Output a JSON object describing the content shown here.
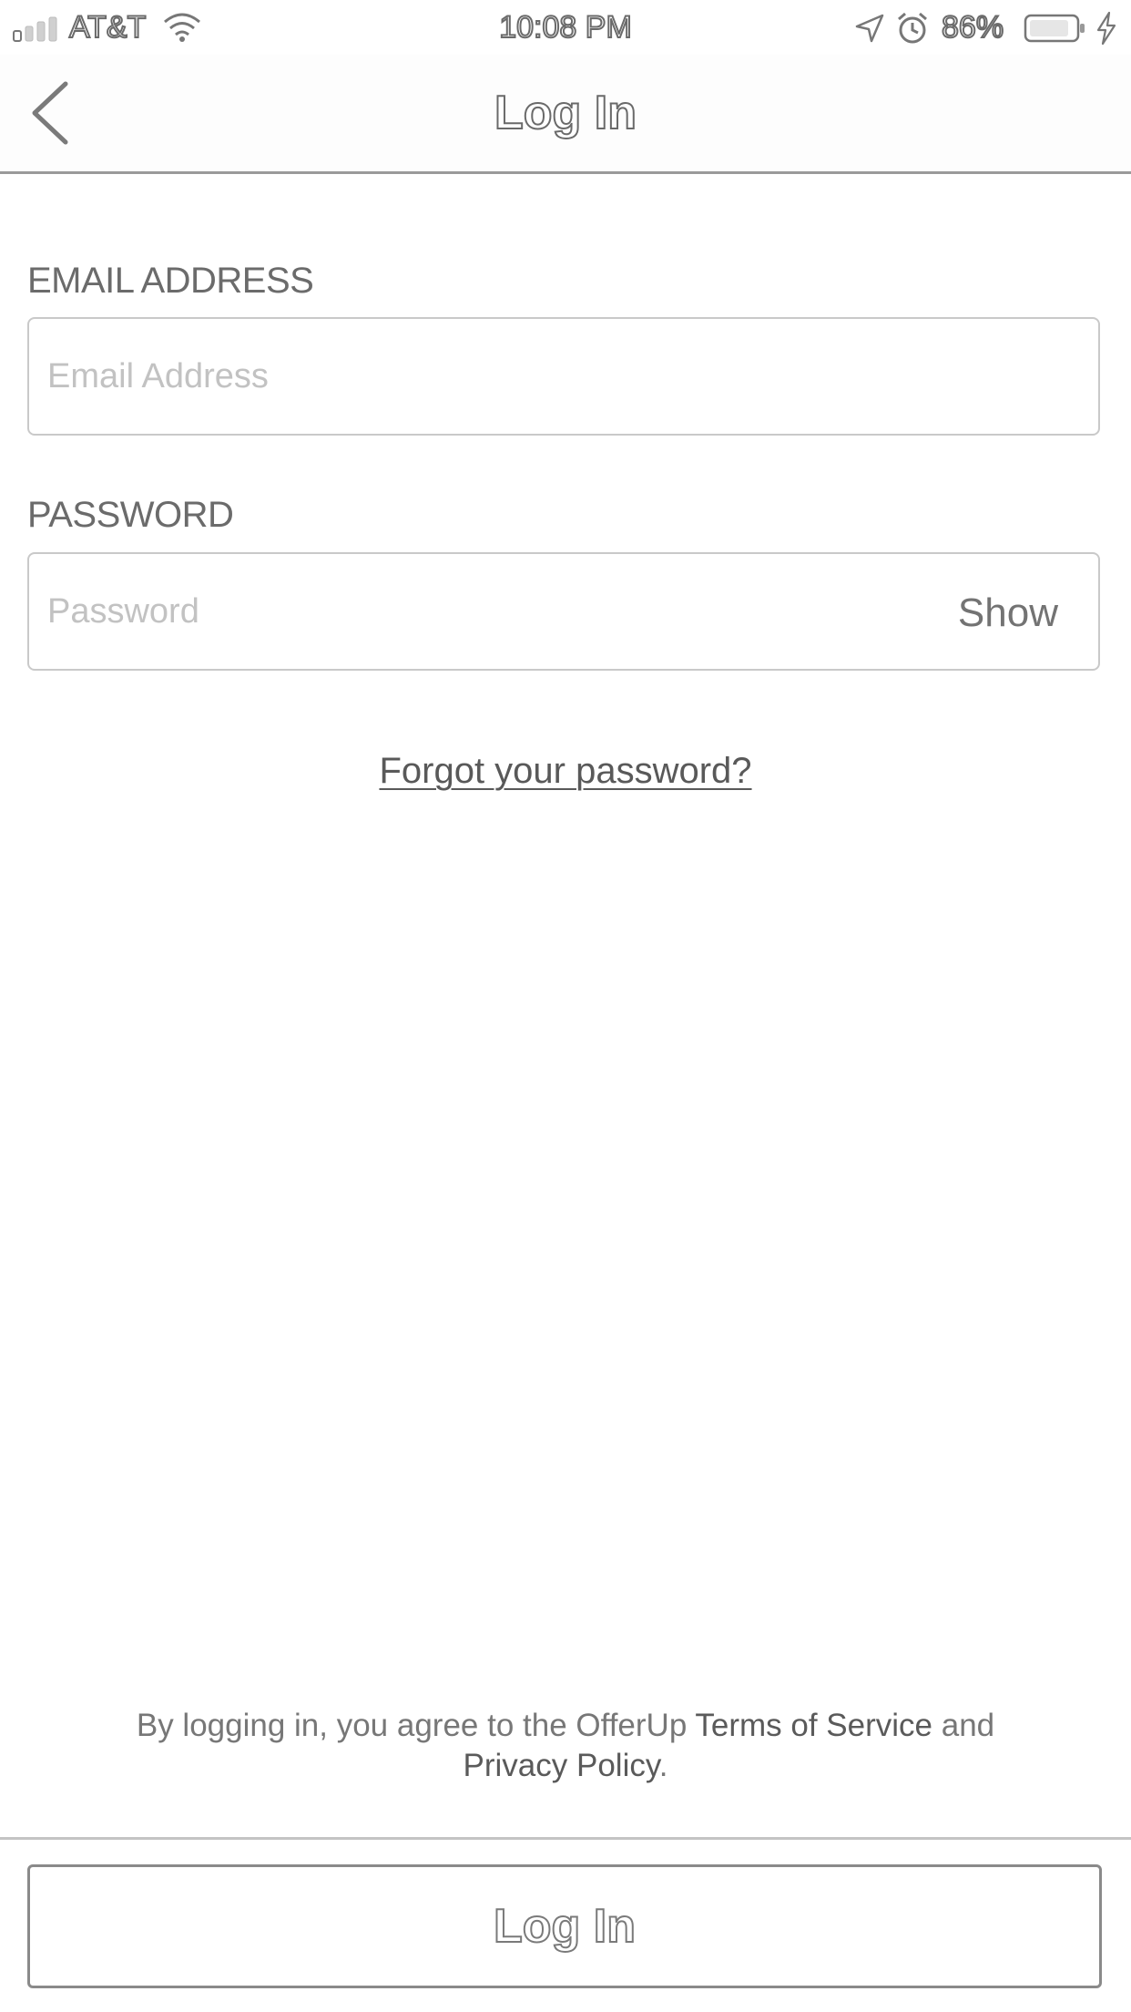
{
  "status_bar": {
    "carrier": "AT&T",
    "time": "10:08 PM",
    "battery_percent": "86%",
    "icons": [
      "signal-icon",
      "wifi-icon",
      "location-icon",
      "alarm-icon",
      "battery-icon",
      "charging-icon"
    ]
  },
  "nav": {
    "title": "Log In",
    "back_icon": "chevron-left-icon"
  },
  "form": {
    "email": {
      "label": "EMAIL ADDRESS",
      "placeholder": "Email Address",
      "value": ""
    },
    "password": {
      "label": "PASSWORD",
      "placeholder": "Password",
      "value": "",
      "show_label": "Show"
    },
    "forgot_password": "Forgot your password?"
  },
  "footer": {
    "legal_prefix": "By logging in, you agree to the OfferUp ",
    "terms_link": "Terms of Service",
    "legal_middle": " and",
    "privacy_link": "Privacy Policy",
    "legal_suffix": ".",
    "login_button": "Log In"
  },
  "colors": {
    "text_gray": "#6b6b6b",
    "placeholder_gray": "#c2c2c2",
    "border_gray": "#c9c9c9",
    "divider_gray": "#9a9a9a"
  }
}
